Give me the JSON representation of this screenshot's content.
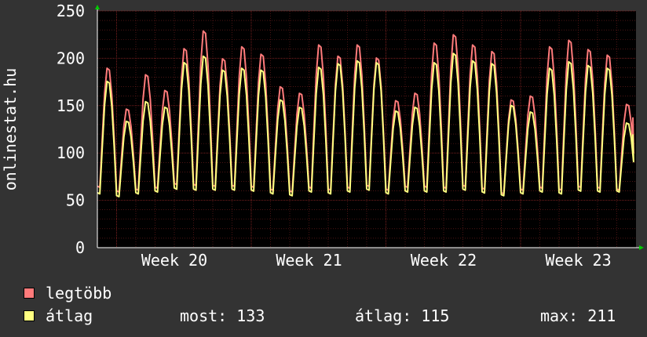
{
  "chart_data": {
    "type": "line",
    "ylabel": "onlinestat.hu",
    "ylim": [
      0,
      250
    ],
    "y_ticks": [
      0,
      50,
      100,
      150,
      200,
      250
    ],
    "x_tick_labels": [
      "Week 20",
      "Week 21",
      "Week 22",
      "Week 23"
    ],
    "grid": true,
    "days": 28,
    "series": [
      {
        "name": "legtöbb",
        "color": "#ff7b7b",
        "daily_peaks": [
          192,
          148,
          185,
          168,
          213,
          232,
          202,
          215,
          207,
          172,
          165,
          217,
          205,
          217,
          203,
          157,
          165,
          219,
          228,
          217,
          210,
          158,
          162,
          215,
          222,
          212,
          206,
          153
        ],
        "daily_mins": [
          65,
          60,
          62,
          64,
          68,
          67,
          66,
          66,
          65,
          62,
          60,
          64,
          62,
          64,
          66,
          62,
          65,
          65,
          64,
          66,
          63,
          58,
          62,
          64,
          62,
          65,
          64,
          62
        ]
      },
      {
        "name": "átlag",
        "color": "#ffff80",
        "daily_peaks": [
          178,
          135,
          156,
          150,
          198,
          205,
          190,
          192,
          190,
          158,
          150,
          193,
          197,
          200,
          198,
          146,
          150,
          198,
          208,
          200,
          197,
          152,
          145,
          192,
          199,
          195,
          192,
          133
        ],
        "daily_mins": [
          58,
          55,
          58,
          60,
          63,
          62,
          62,
          62,
          61,
          58,
          56,
          60,
          58,
          60,
          62,
          58,
          60,
          60,
          60,
          62,
          59,
          56,
          58,
          60,
          58,
          61,
          60,
          60
        ]
      }
    ]
  },
  "legend": {
    "items": [
      {
        "label": "legtöbb",
        "color": "#ff7b7b"
      },
      {
        "label": "átlag",
        "color": "#ffff80"
      }
    ]
  },
  "stats": {
    "now": "most: 133",
    "avg": "átlag: 115",
    "max": "max: 211"
  },
  "colors": {
    "background": "#333333",
    "plot_background": "#000000",
    "grid": "#7a2020",
    "axis": "#ffffff",
    "arrow": "#00cc00"
  }
}
